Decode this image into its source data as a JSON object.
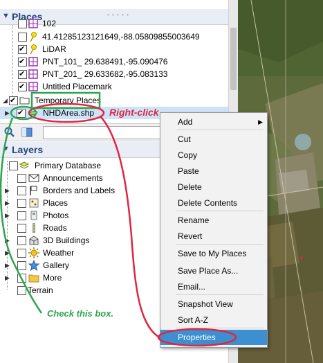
{
  "places_panel": {
    "title": "Places",
    "items": [
      {
        "label": "102",
        "icon": "placemark-grid-icon",
        "checked": false
      },
      {
        "label": "41.41285123121649,-88.05809855003649",
        "icon": "pushpin-icon",
        "checked": false
      },
      {
        "label": "LiDAR",
        "icon": "pushpin-icon",
        "checked": true
      },
      {
        "label": "PNT_101_ 29.638491,-95.090476",
        "icon": "placemark-grid-icon",
        "checked": true
      },
      {
        "label": "PNT_201_ 29.633682,-95.083133",
        "icon": "placemark-grid-icon",
        "checked": true
      },
      {
        "label": "Untitled Placemark",
        "icon": "placemark-grid-icon",
        "checked": true
      }
    ],
    "temporary_places": {
      "label": "Temporary Places",
      "checked": true
    },
    "selected_item": {
      "label": "NHDArea.shp",
      "checked": true
    }
  },
  "layers_panel": {
    "title": "Layers",
    "items": [
      {
        "label": "Primary Database",
        "icon": "database-icon",
        "checked": false
      },
      {
        "label": "Announcements",
        "icon": "envelope-icon",
        "checked": false
      },
      {
        "label": "Borders and Labels",
        "icon": "flag-icon",
        "checked": false
      },
      {
        "label": "Places",
        "icon": "places-icon",
        "checked": false
      },
      {
        "label": "Photos",
        "icon": "photo-icon",
        "checked": false
      },
      {
        "label": "Roads",
        "icon": "road-icon",
        "checked": false
      },
      {
        "label": "3D Buildings",
        "icon": "building-icon",
        "checked": false
      },
      {
        "label": "Weather",
        "icon": "sun-icon",
        "checked": false
      },
      {
        "label": "Gallery",
        "icon": "star-icon",
        "checked": false
      },
      {
        "label": "More",
        "icon": "folder-icon",
        "checked": false
      },
      {
        "label": "Terrain",
        "icon": "terrain-icon",
        "checked": false
      }
    ]
  },
  "context_menu": {
    "items": [
      {
        "label": "Add",
        "submenu": true
      },
      {
        "label": "Cut"
      },
      {
        "label": "Copy"
      },
      {
        "label": "Paste"
      },
      {
        "label": "Delete"
      },
      {
        "label": "Delete Contents"
      },
      {
        "label": "Rename"
      },
      {
        "label": "Revert"
      },
      {
        "label": "Save to My Places"
      },
      {
        "label": "Save Place As..."
      },
      {
        "label": "Email..."
      },
      {
        "label": "Snapshot View"
      },
      {
        "label": "Sort A-Z"
      },
      {
        "label": "Properties",
        "selected": true
      }
    ]
  },
  "annotations": {
    "right_click": "Right-click",
    "check_box": "Check this box."
  },
  "colors": {
    "annotation_red": "#e0263f",
    "annotation_green": "#2ea44f",
    "menu_highlight": "#3c8fd1",
    "selection": "#cde3f8",
    "panel_title": "#23457a"
  }
}
